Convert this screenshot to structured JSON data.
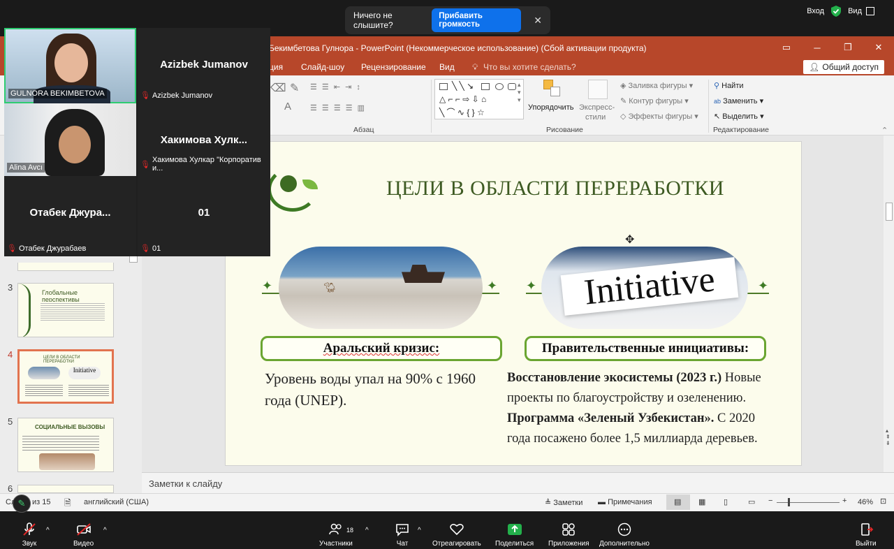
{
  "zoom_top": {
    "notice_text": "Ничего не слышите?",
    "notice_button": "Прибавить громкость",
    "close": "✕",
    "login": "Вход",
    "view": "Вид"
  },
  "ppt": {
    "title": "Бекимбетова Гулнора - PowerPoint (Некоммерческое использование) (Сбой активации продукта)",
    "menu": [
      "ция",
      "Слайд-шоу",
      "Рецензирование",
      "Вид",
      "Что вы хотите сделать?"
    ],
    "share": "Общий доступ",
    "ribbon": {
      "paragraph_label": "Абзац",
      "drawing_label": "Рисование",
      "editing_label": "Редактирование",
      "arrange": "Упорядочить",
      "quick_styles_1": "Экспресс-",
      "quick_styles_2": "стили",
      "fill": "Заливка фигуры",
      "outline": "Контур фигуры",
      "effects": "Эффекты фигуры",
      "find": "Найти",
      "replace": "Заменить",
      "select": "Выделить"
    },
    "slide": {
      "title": "ЦЕЛИ В ОБЛАСТИ ПЕРЕРАБОТКИ",
      "left_label": "Аральский кризис:",
      "left_body": "Уровень воды упал на 90% с 1960 года (UNEP).",
      "right_label": "Правительственные инициативы:",
      "right_b1": "Восстановление экосистемы (2023 г.)",
      "right_t1": " Новые проекты по благоустройству и озеленению.",
      "right_b2": "Программа «Зеленый Узбекистан».",
      "right_t2": " С 2020 года посажено более 1,5 миллиарда деревьев.",
      "initiative_word": "Initiative"
    },
    "thumbs": [
      {
        "num": "3",
        "title": "Глобальные перспективы"
      },
      {
        "num": "4",
        "title": "ЦЕЛИ В ОБЛАСТИ ПЕРЕРАБОТКИ"
      },
      {
        "num": "5",
        "title": "СОЦИАЛЬНЫЕ ВЫЗОВЫ"
      },
      {
        "num": "6",
        "title": ""
      }
    ],
    "notes_placeholder": "Заметки к слайду",
    "status": {
      "slide_of": "из 15",
      "slide_prefix": "Сл",
      "language": "английский (США)",
      "notes": "Заметки",
      "comments": "Примечания",
      "zoom": "46%"
    }
  },
  "gallery": [
    {
      "name": "GULNORA BEKIMBETOVA",
      "big": ""
    },
    {
      "name": "Azizbek Jumanov",
      "big": "Azizbek Jumanov"
    },
    {
      "name": "Alina Avcı",
      "big": ""
    },
    {
      "name": "Хакимова Хулкар \"Корпоратив и...",
      "big": "Хакимова  Хулк..."
    },
    {
      "name": "Отабек Джурабаев",
      "big": "Отабек  Джура..."
    },
    {
      "name": "01",
      "big": "01"
    }
  ],
  "zoom_bottom": {
    "mic": "Звук",
    "video": "Видео",
    "participants": "Участники",
    "participants_count": "18",
    "chat": "Чат",
    "react": "Отреагировать",
    "share": "Поделиться",
    "apps": "Приложения",
    "more": "Дополнительно",
    "leave": "Выйти"
  }
}
